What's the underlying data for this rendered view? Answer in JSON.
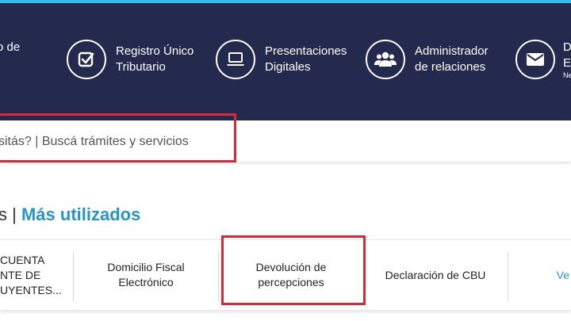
{
  "nav": {
    "items": [
      {
        "line1": "o de",
        "line2": "",
        "icon": "document-icon"
      },
      {
        "line1": "Registro Único",
        "line2": "Tributario",
        "icon": "checkbox-icon"
      },
      {
        "line1": "Presentaciones",
        "line2": "Digitales",
        "icon": "laptop-icon"
      },
      {
        "line1": "Administrador",
        "line2": "de relaciones",
        "icon": "users-icon"
      },
      {
        "line1": "D",
        "line2": "E",
        "sub": "Ne",
        "icon": "envelope-icon"
      }
    ]
  },
  "search": {
    "text": "sitás? | Buscá trámites y servicios"
  },
  "section": {
    "prefix": "s",
    "separator": "|",
    "title": "Más utilizados"
  },
  "cards": [
    {
      "lines": [
        "CUENTA",
        "NTE DE",
        "UYENTES..."
      ]
    },
    {
      "lines": [
        "Domicilio Fiscal",
        "Electrónico"
      ]
    },
    {
      "lines": [
        "Devolución de",
        "percepciones"
      ]
    },
    {
      "lines": [
        "Declaración de CBU"
      ]
    },
    {
      "lines": [
        "Ve"
      ]
    }
  ],
  "colors": {
    "nav_bg": "#242a4d",
    "accent": "#2596c6",
    "highlight": "#d62b36"
  }
}
